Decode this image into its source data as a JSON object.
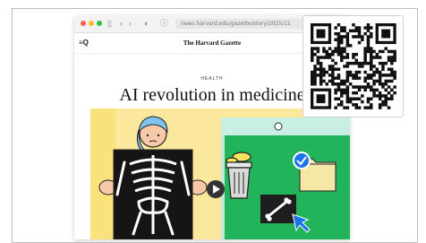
{
  "browser": {
    "url": "news.harvard.edu/gazette/story/2025/11",
    "icons": [
      "sidebar-icon",
      "back-icon",
      "forward-icon",
      "shield-icon",
      "info-icon"
    ]
  },
  "site": {
    "menu_label": "≡Q",
    "title": "The Harvard Gazette"
  },
  "article": {
    "kicker": "HEALTH",
    "headline": "AI revolution in medicine"
  },
  "overlay": {
    "qr_code": "qr-code-image"
  },
  "colors": {
    "hero_yellow": "#fbe89c",
    "hero_green": "#22b45a",
    "accent_blue": "#1a73e8"
  }
}
